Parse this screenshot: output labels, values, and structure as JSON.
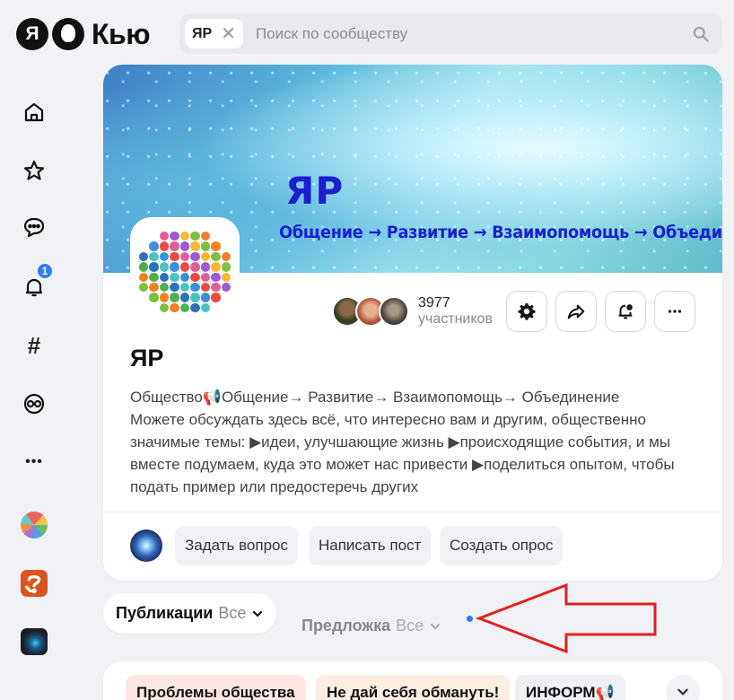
{
  "header": {
    "logo_ya": "Я",
    "logo_text": "Кью",
    "search": {
      "chip_label": "ЯР",
      "chip_close": "✕",
      "placeholder": "Поиск по сообществу"
    }
  },
  "sidebar": {
    "items": [
      {
        "name": "home",
        "icon": "home-icon"
      },
      {
        "name": "favorites",
        "icon": "star-icon"
      },
      {
        "name": "messages",
        "icon": "chat-icon"
      },
      {
        "name": "notifications",
        "icon": "bell-icon",
        "badge": "1"
      },
      {
        "name": "topics",
        "icon": "hashtag-icon",
        "glyph": "#"
      },
      {
        "name": "communities",
        "icon": "community-icon"
      },
      {
        "name": "more",
        "icon": "more-icon",
        "glyph": "•••"
      },
      {
        "name": "community-yar",
        "icon": "community-yar-thumb"
      },
      {
        "name": "community-2",
        "icon": "community-2-thumb"
      },
      {
        "name": "community-3",
        "icon": "community-3-thumb"
      }
    ]
  },
  "community": {
    "banner_title": "ЯР",
    "banner_subtitle": "Общение → Развитие → Взаимопомощь → Объединение",
    "members_count": "3977",
    "members_label": "участников",
    "name": "ЯР",
    "description_line1": "Общество📢Общение→ Развитие→ Взаимопомощь→ Объединение",
    "description_rest": "Можете обсуждать здесь всё, что интересно вам и другим, общественно значимые темы: ▶идеи, улучшающие жизнь ▶происходящие события, и мы вместе подумаем, куда это может нас привести ▶поделиться опытом, чтобы подать пример или предостеречь других",
    "actions": {
      "ask": "Задать вопрос",
      "post": "Написать пост",
      "poll": "Создать опрос"
    }
  },
  "tabs": {
    "publications": "Публикации",
    "publications_filter": "Все",
    "suggestions": "Предложка",
    "suggestions_filter": "Все"
  },
  "tags": [
    {
      "label": "Проблемы общества",
      "color": "#fde8e4"
    },
    {
      "label": "Не дай себя обмануть!",
      "color": "#fdeee3"
    },
    {
      "label": "ИНФОРМ📢",
      "color": "#eef0f4"
    }
  ],
  "colors": {
    "accent": "#2e7cf6",
    "annotation_arrow": "#e02020",
    "banner_text": "#1a1fd0"
  }
}
